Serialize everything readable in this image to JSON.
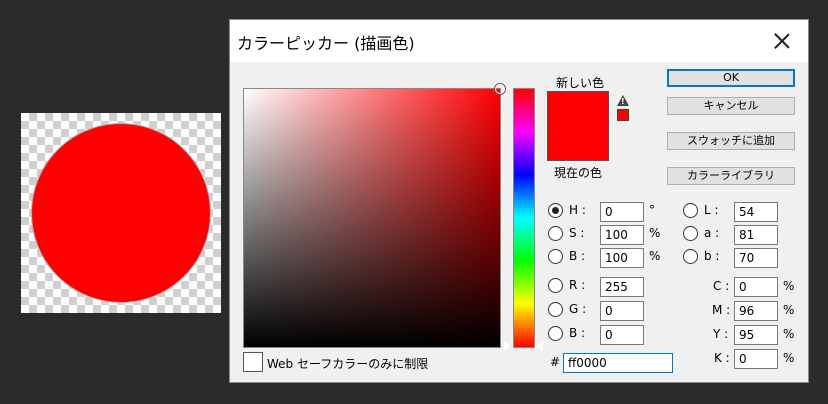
{
  "dialog": {
    "title": "カラーピッカー (描画色)",
    "new_label": "新しい色",
    "current_label": "現在の色",
    "buttons": {
      "ok": "OK",
      "cancel": "キャンセル",
      "add_swatch": "スウォッチに追加",
      "libraries": "カラーライブラリ"
    },
    "hsb": {
      "h_label": "H :",
      "h_value": "0",
      "h_unit": "°",
      "s_label": "S :",
      "s_value": "100",
      "s_unit": "%",
      "b_label": "B :",
      "b_value": "100",
      "b_unit": "%"
    },
    "rgb": {
      "r_label": "R :",
      "r_value": "255",
      "g_label": "G :",
      "g_value": "0",
      "b_label": "B :",
      "b_value": "0"
    },
    "lab": {
      "l_label": "L :",
      "l_value": "54",
      "a_label": "a :",
      "a_value": "81",
      "b_label": "b :",
      "b_value": "70"
    },
    "cmyk": {
      "c_label": "C :",
      "c_value": "0",
      "c_unit": "%",
      "m_label": "M :",
      "m_value": "96",
      "m_unit": "%",
      "y_label": "Y :",
      "y_value": "95",
      "y_unit": "%",
      "k_label": "K :",
      "k_value": "0",
      "k_unit": "%"
    },
    "hex_label": "#",
    "hex_value": "ff0000",
    "web_safe_label": "Web セーフカラーのみに制限",
    "warning_glyph": "!",
    "selected_color": "#ff0000"
  }
}
